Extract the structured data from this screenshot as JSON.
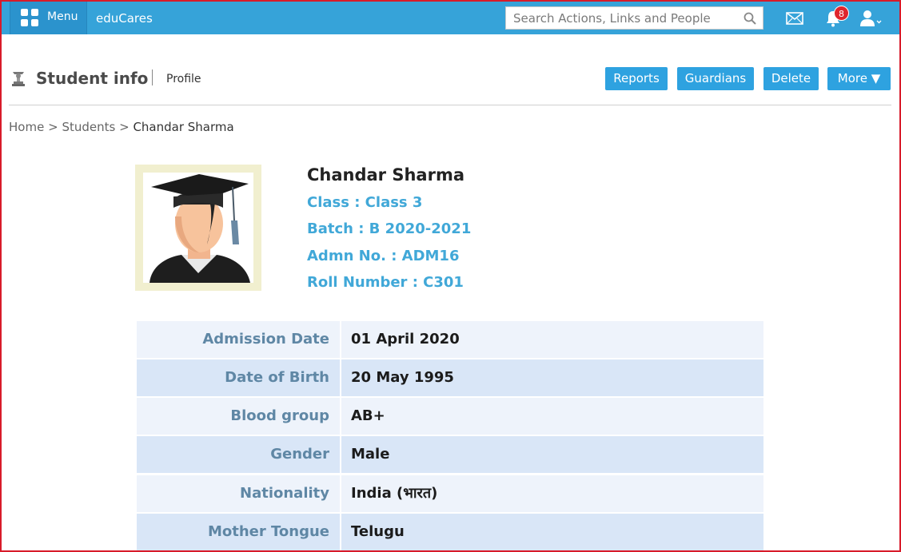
{
  "topbar": {
    "menu_label": "Menu",
    "brand": "eduCares",
    "search_placeholder": "Search Actions, Links and People",
    "notification_count": "8"
  },
  "header": {
    "title": "Student info",
    "subtitle": "Profile",
    "buttons": [
      "Reports",
      "Guardians",
      "Delete",
      "More ▼"
    ]
  },
  "breadcrumb": {
    "home": "Home",
    "sep": ">",
    "students": "Students",
    "current": "Chandar Sharma"
  },
  "student": {
    "name": "Chandar Sharma",
    "class": "Class : Class 3",
    "batch": "Batch : B 2020-2021",
    "admn": "Admn No. : ADM16",
    "roll": "Roll Number : C301"
  },
  "details": [
    {
      "label": "Admission Date",
      "value": "01 April 2020"
    },
    {
      "label": "Date of Birth",
      "value": "20 May 1995"
    },
    {
      "label": "Blood group",
      "value": "AB+"
    },
    {
      "label": "Gender",
      "value": "Male"
    },
    {
      "label": "Nationality",
      "value": "India (भारत)"
    },
    {
      "label": "Mother Tongue",
      "value": "Telugu"
    }
  ]
}
